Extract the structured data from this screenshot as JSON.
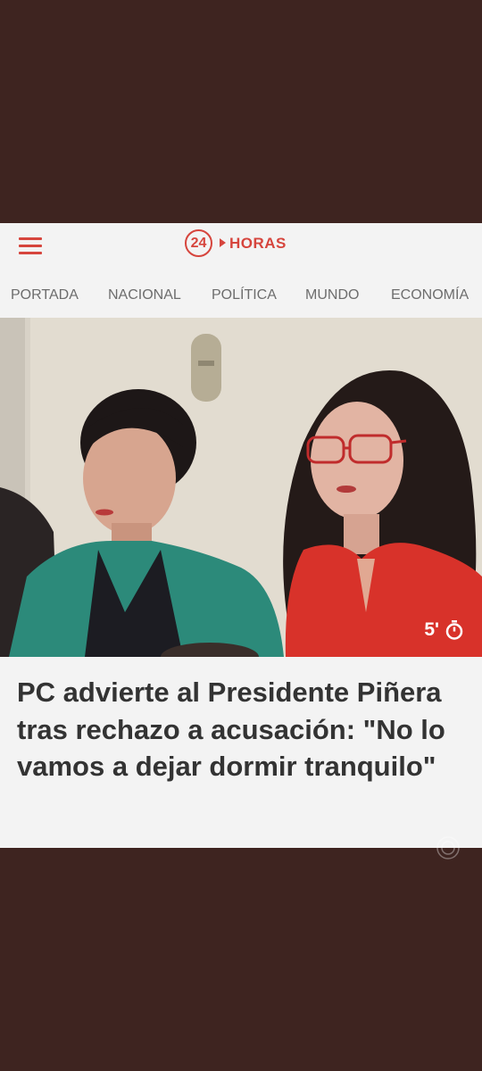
{
  "header": {
    "logo_number": "24",
    "logo_text": "HORAS"
  },
  "nav": {
    "items": [
      "PORTADA",
      "NACIONAL",
      "POLÍTICA",
      "MUNDO",
      "ECONOMÍA"
    ]
  },
  "article": {
    "duration": "5'",
    "headline": "PC advierte al Presidente Piñera tras rechazo a acusación: \"No lo vamos a dejar dormir tranquilo\""
  },
  "colors": {
    "brand": "#d6453d",
    "background": "#3e2420",
    "card": "#f3f3f3"
  }
}
